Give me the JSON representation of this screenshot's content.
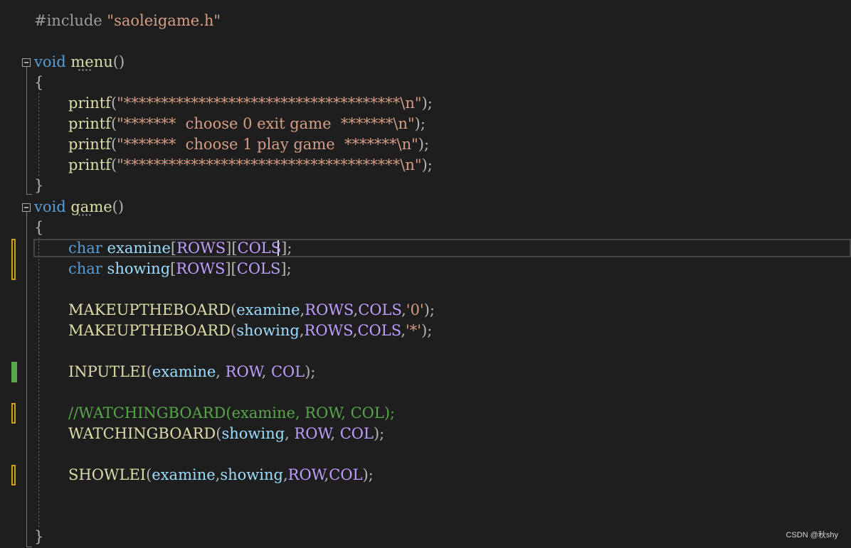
{
  "code": {
    "include": {
      "directive": "#include",
      "file": "\"saoleigame.h\""
    },
    "menu": {
      "ret": "void",
      "name": "menu",
      "params": "()",
      "open": "{",
      "close": "}",
      "printf": [
        {
          "fn": "printf",
          "open": "(",
          "str": "\"*************************************\\n\"",
          "end": ");"
        },
        {
          "fn": "printf",
          "open": "(",
          "str": "\"*******  choose 0 exit game  *******\\n\"",
          "end": ");"
        },
        {
          "fn": "printf",
          "open": "(",
          "str": "\"*******  choose 1 play game  *******\\n\"",
          "end": ");"
        },
        {
          "fn": "printf",
          "open": "(",
          "str": "\"*************************************\\n\"",
          "end": ");"
        }
      ]
    },
    "game": {
      "ret": "void",
      "name": "game",
      "params": "()",
      "open": "{",
      "close": "}",
      "decl1": {
        "type": "char",
        "var": "examine",
        "b1": "[",
        "m1": "ROWS",
        "b2": "][",
        "m2": "COLS",
        "end": "];"
      },
      "decl2": {
        "type": "char",
        "var": "showing",
        "b1": "[",
        "m1": "ROWS",
        "b2": "][",
        "m2": "COLS",
        "end": "];"
      },
      "make1": {
        "fn": "MAKEUPTHEBOARD",
        "o": "(",
        "a1": "examine",
        "c1": ",",
        "m1": "ROWS",
        "c2": ",",
        "m2": "COLS",
        "c3": ",",
        "lit": "'0'",
        "end": ");"
      },
      "make2": {
        "fn": "MAKEUPTHEBOARD",
        "o": "(",
        "a1": "showing",
        "c1": ",",
        "m1": "ROWS",
        "c2": ",",
        "m2": "COLS",
        "c3": ",",
        "lit": "'*'",
        "end": ");"
      },
      "input": {
        "fn": "INPUTLEI",
        "o": "(",
        "a1": "examine",
        "c1": ", ",
        "m1": "ROW",
        "c2": ", ",
        "m2": "COL",
        "end": ");"
      },
      "comment": "//WATCHINGBOARD(examine, ROW, COL);",
      "watch": {
        "fn": "WATCHINGBOARD",
        "o": "(",
        "a1": "showing",
        "c1": ", ",
        "m1": "ROW",
        "c2": ", ",
        "m2": "COL",
        "end": ");"
      },
      "show": {
        "fn": "SHOWLEI",
        "o": "(",
        "a1": "examine",
        "c1": ",",
        "a2": "showing",
        "c2": ",",
        "m1": "ROW",
        "c3": ",",
        "m2": "COL",
        "end": ");"
      }
    }
  },
  "watermark": "CSDN @秋shy",
  "colors": {
    "background": "#1e1e1e",
    "keyword": "#569cd6",
    "function": "#dcdcaa",
    "string": "#d69d85",
    "macro": "#bd9fff",
    "variable": "#9cdcfe",
    "comment": "#57a64a",
    "change_marker_saved": "#57a64a",
    "change_marker_unsaved": "#c7a024"
  }
}
